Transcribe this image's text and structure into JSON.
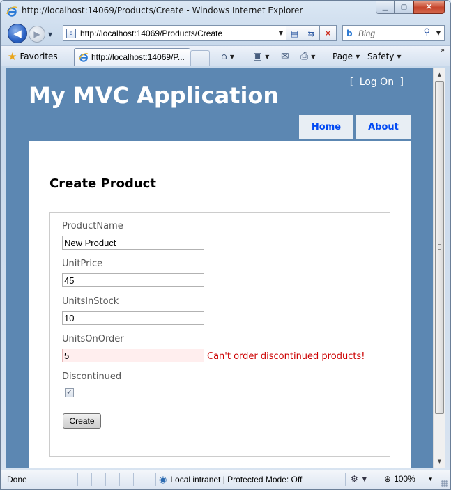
{
  "window": {
    "title": "http://localhost:14069/Products/Create - Windows Internet Explorer",
    "minimize_icon": "minimize-icon",
    "maximize_icon": "maximize-icon",
    "close_icon": "close-icon"
  },
  "address_bar": {
    "url": "http://localhost:14069/Products/Create"
  },
  "search_box": {
    "placeholder": "Bing"
  },
  "favorites_bar": {
    "favorites_label": "Favorites",
    "tab_title": "http://localhost:14069/P..."
  },
  "command_bar": {
    "page_label": "Page",
    "safety_label": "Safety",
    "more": "»"
  },
  "site": {
    "title": "My MVC Application",
    "login_open_bracket": "[",
    "login_link": "Log On",
    "login_close_bracket": "]",
    "menu": [
      {
        "label": "Home"
      },
      {
        "label": "About"
      }
    ]
  },
  "form": {
    "heading": "Create Product",
    "fields": {
      "product_name": {
        "label": "ProductName",
        "value": "New Product"
      },
      "unit_price": {
        "label": "UnitPrice",
        "value": "45"
      },
      "units_in_stock": {
        "label": "UnitsInStock",
        "value": "10"
      },
      "units_on_order": {
        "label": "UnitsOnOrder",
        "value": "5",
        "error": "Can't order discontinued products!"
      },
      "discontinued": {
        "label": "Discontinued",
        "checked": true
      }
    },
    "submit_label": "Create"
  },
  "status_bar": {
    "status": "Done",
    "zone": "Local intranet | Protected Mode: Off",
    "zoom": "100%"
  },
  "colors": {
    "page_background": "#5c87b2",
    "menu_link": "#034af3",
    "error": "#cc0000",
    "error_input_bg": "#ffeeee"
  }
}
